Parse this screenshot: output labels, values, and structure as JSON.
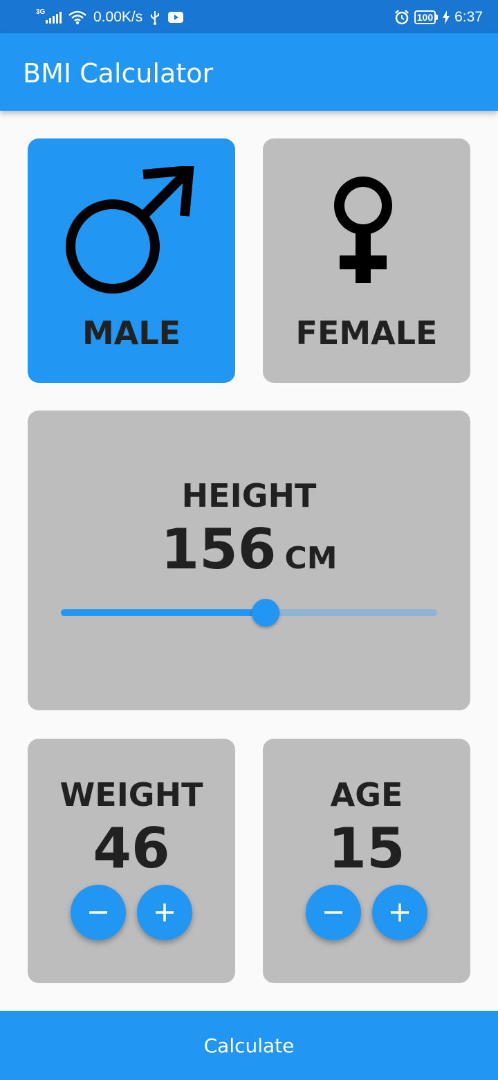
{
  "status_bar": {
    "network": "3G",
    "speed": "0.00K/s",
    "battery": "100",
    "time": "6:37",
    "icons": [
      "signal-icon",
      "wifi-icon",
      "usb-icon",
      "youtube-icon",
      "alarm-icon",
      "battery-icon",
      "charging-icon"
    ]
  },
  "app_bar": {
    "title": "BMI Calculator"
  },
  "gender": {
    "male": {
      "label": "MALE",
      "icon": "male-symbol-icon",
      "selected": true
    },
    "female": {
      "label": "FEMALE",
      "icon": "female-symbol-icon",
      "selected": false
    }
  },
  "height": {
    "label": "HEIGHT",
    "value": "156",
    "unit": "CM",
    "slider_fraction": 0.545
  },
  "weight": {
    "label": "WEIGHT",
    "value": "46"
  },
  "age": {
    "label": "AGE",
    "value": "15"
  },
  "calculate": {
    "label": "Calculate"
  },
  "colors": {
    "primary": "#2196f3",
    "status_bar": "#1976d2",
    "card": "#bdbdbd",
    "text": "#212121"
  }
}
